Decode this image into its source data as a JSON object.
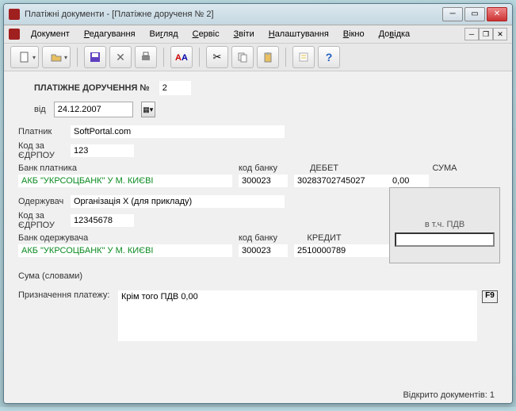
{
  "window": {
    "title": "Платіжні документи - [Платіжне дорученя № 2]"
  },
  "menu": {
    "document": "Документ",
    "edit": "Редагування",
    "view": "Вигляд",
    "service": "Сервіс",
    "reports": "Звіти",
    "settings": "Налаштування",
    "window_menu": "Вікно",
    "help": "Довідка"
  },
  "form": {
    "heading": "ПЛАТІЖНЕ ДОРУЧЕННЯ №",
    "number": "2",
    "date_label": "від",
    "date": "24.12.2007",
    "payer_label": "Платник",
    "payer": "SoftPortal.com",
    "edrpou_label": "Код за ЄДРПОУ",
    "payer_edrpou": "123",
    "payer_bank_label": "Банк платника",
    "bank_code_label": "код банку",
    "debit_label": "ДЕБЕТ",
    "sum_label": "СУМА",
    "payer_bank": "АКБ \"УКРСОЦБАНК\" У М. КИЄВІ",
    "payer_bank_code": "300023",
    "payer_account": "30283702745027",
    "sum": "0,00",
    "vat_label": "в т.ч. ПДВ",
    "recipient_label": "Одержувач",
    "recipient": "Організація X (для прикладу)",
    "recipient_edrpou": "12345678",
    "recipient_bank_label": "Банк одержувача",
    "credit_label": "КРЕДИТ",
    "recipient_bank": "АКБ \"УКРСОЦБАНК\" У М. КИЄВІ",
    "recipient_bank_code": "300023",
    "recipient_account": "2510000789",
    "sum_words_label": "Сума (словами)",
    "purpose_label": "Призначення платежу:",
    "purpose": "Крім того ПДВ 0,00",
    "f9": "F9"
  },
  "status": {
    "open_docs": "Відкрито документів: 1"
  }
}
